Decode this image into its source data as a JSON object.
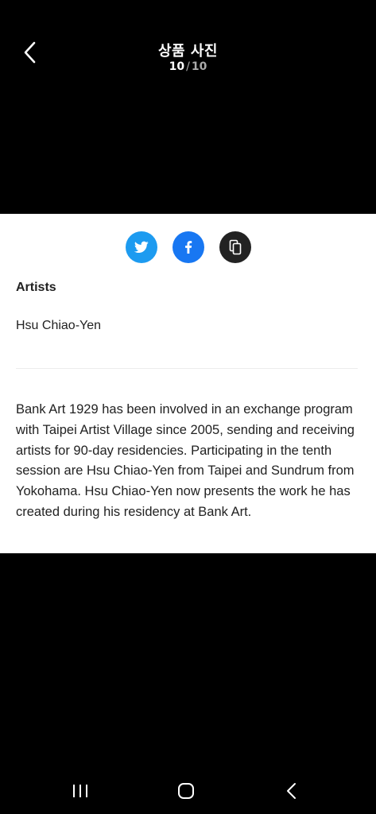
{
  "header": {
    "title": "상품 사진",
    "current": "10",
    "separator": "/",
    "total": "10"
  },
  "share": {
    "twitter_icon": "twitter-icon",
    "facebook_icon": "facebook-icon",
    "copy_icon": "copy-icon",
    "colors": {
      "twitter": "#1d9bf0",
      "facebook": "#1877f2",
      "copy": "#222222"
    }
  },
  "details": {
    "section_label": "Artists",
    "artist": "Hsu Chiao-Yen",
    "description": "Bank Art 1929 has been involved in an exchange program with Taipei Artist Village since 2005, sending and receiving artists for 90-day residencies. Participating in the tenth session are Hsu Chiao-Yen from Taipei and Sundrum from Yokohama. Hsu Chiao-Yen now presents the work he has created during his residency at Bank Art."
  },
  "navbar": {
    "recents_icon": "recents-icon",
    "home_icon": "home-icon",
    "back_icon": "back-icon"
  }
}
